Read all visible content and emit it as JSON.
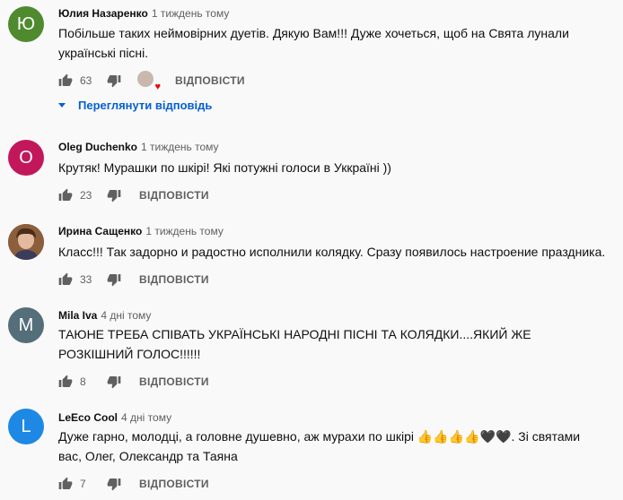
{
  "comments": [
    {
      "author": "Юлия Назаренко",
      "time": "1 тиждень тому",
      "avatar_letter": "Ю",
      "avatar_color": "#4f8a2f",
      "text": "Побільше таких неймовірних дуетів. Дякую Вам!!!  Дуже хочеться, щоб на Свята лунали українські пісні.",
      "likes": "63",
      "reply_label": "ВІДПОВІСТИ",
      "view_replies": "Переглянути відповідь"
    },
    {
      "author": "Oleg Duchenko",
      "time": "1 тиждень тому",
      "avatar_letter": "O",
      "avatar_color": "#c2185b",
      "text": "Крутяк! Мурашки по шкірі! Які потужні голоси в Уккраїні ))",
      "likes": "23",
      "reply_label": "ВІДПОВІСТИ"
    },
    {
      "author": "Ирина Сащенко",
      "time": "1 тиждень тому",
      "avatar_letter": "",
      "avatar_color": "#7a5a3c",
      "text": "Класс!!! Так задорно и радостно исполнили колядку. Сразу появилось настроение праздника.",
      "likes": "33",
      "reply_label": "ВІДПОВІСТИ"
    },
    {
      "author": "Mila Iva",
      "time": "4 дні тому",
      "avatar_letter": "M",
      "avatar_color": "#546e7a",
      "text": "ТАЮНЕ ТРЕБА СПІВАТЬ УКРАЇНСЬКІ НАРОДНІ ПІСНІ ТА КОЛЯДКИ....ЯКИЙ ЖЕ РОЗКІШНИЙ ГОЛОС!!!!!!",
      "likes": "8",
      "reply_label": "ВІДПОВІСТИ"
    },
    {
      "author": "LeEco Cool",
      "time": "4 дні тому",
      "avatar_letter": "L",
      "avatar_color": "#1e88e5",
      "text": "Дуже гарно, молодці, а головне душевно, аж мурахи по шкірі  👍👍👍👍🖤🖤. Зі святами вас, Олег, Олександр та Таяна",
      "likes": "7",
      "reply_label": "ВІДПОВІСТИ"
    }
  ],
  "icons": {
    "like": "thumb-up-icon",
    "dislike": "thumb-down-icon",
    "creator_heart": "creator-heart-icon",
    "expand": "caret-down-icon"
  },
  "colors": {
    "link": "#065fd4",
    "secondary_text": "#606060",
    "background": "#f9f9f9"
  }
}
